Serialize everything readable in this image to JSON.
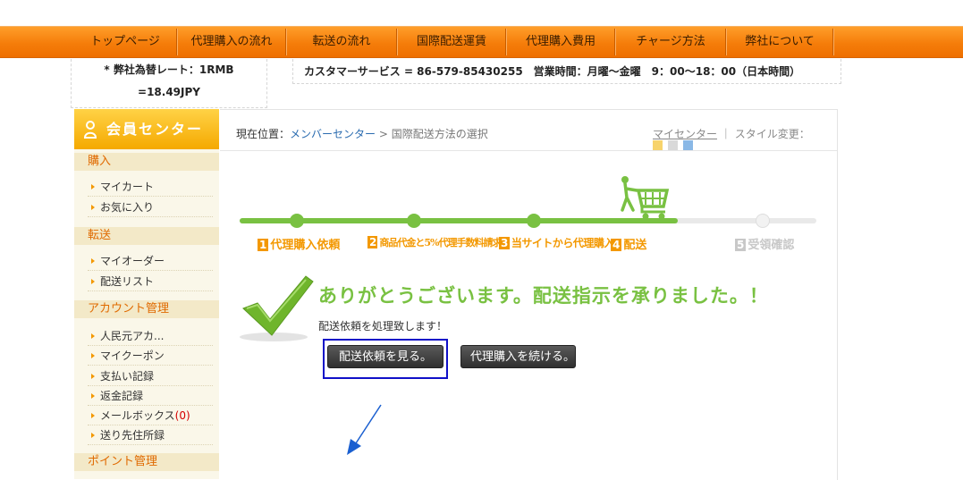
{
  "nav": {
    "items": [
      "トップページ",
      "代理購入の流れ",
      "転送の流れ",
      "国際配送運賃",
      "代理購入費用",
      "チャージ方法",
      "弊社について"
    ]
  },
  "info": {
    "rate_line1": "* 弊社為替レート：1RMB",
    "rate_line2": "=18.49JPY",
    "customer_service": "カスタマーサービス = 86-579-85430255　営業時間：月曜～金曜　9：00～18：00（日本時間）"
  },
  "sidebar": {
    "title": "会員センター",
    "sections": [
      {
        "heading": "購入",
        "items": [
          "マイカート",
          "お気に入り"
        ]
      },
      {
        "heading": "転送",
        "items": [
          "マイオーダー",
          "配送リスト"
        ]
      },
      {
        "heading": "アカウント管理",
        "items": [
          "人民元アカ...",
          "マイクーポン",
          "支払い記録",
          "返金記録",
          "メールボックス",
          "送り先住所録"
        ]
      },
      {
        "heading": "ポイント管理",
        "items": []
      }
    ],
    "mailbox_count": "(0)"
  },
  "breadcrumb": {
    "prefix": "現在位置：",
    "link": "メンバーセンター",
    "separator": " > ",
    "current": "国際配送方法の選択"
  },
  "header_right": {
    "my_center": "マイセンター",
    "divider": "｜",
    "style_change": "スタイル変更："
  },
  "style_swatches": [
    "#f7d36b",
    "#d9d9d9",
    "#8ab8e6"
  ],
  "progress": {
    "steps": [
      {
        "num": "1",
        "label": "代理購入依頼"
      },
      {
        "num": "2",
        "label": "商品代金と5%代理手数料請求"
      },
      {
        "num": "3",
        "label": "当サイトから代理購入"
      },
      {
        "num": "4",
        "label": "配送"
      },
      {
        "num": "5",
        "label": "受領確認"
      }
    ],
    "completed": 4
  },
  "success": {
    "title": "ありがとうございます。配送指示を承りました。！",
    "subtitle": "配送依頼を処理致します！",
    "view_button": "配送依頼を見る。",
    "continue_button": "代理購入を続ける。"
  },
  "colors": {
    "nav_orange": "#f57d0a",
    "accent_green": "#79c142",
    "step_orange": "#f39800",
    "highlight_blue": "#1010c8"
  }
}
